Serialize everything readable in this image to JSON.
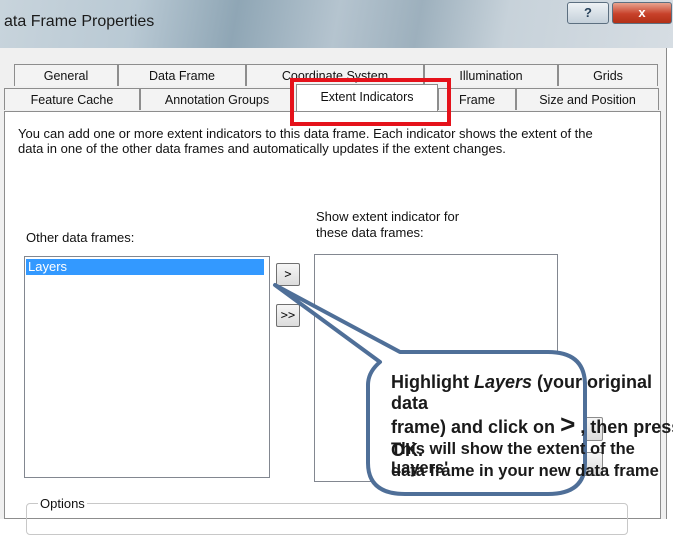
{
  "window": {
    "title": "ata Frame Properties",
    "help_label": "?",
    "close_label": "x"
  },
  "tabs_row1": [
    "General",
    "Data Frame",
    "Coordinate System",
    "Illumination",
    "Grids"
  ],
  "tabs_row2": [
    "Feature Cache",
    "Annotation Groups",
    "Extent Indicators",
    "Frame",
    "Size and Position"
  ],
  "active_tab": "Extent Indicators",
  "description": "You can add one or more extent indicators to this data frame.  Each indicator shows the extent of the data in one of the other data frames and automatically updates if the extent changes.",
  "other_frames": {
    "label": "Other data frames:",
    "items": [
      "Layers"
    ]
  },
  "show_extent": {
    "label_line1": "Show extent indicator for",
    "label_line2": "these data frames:"
  },
  "buttons": {
    "add": ">",
    "add_all": ">>"
  },
  "options_label": "Options",
  "callout": {
    "line1_pre": "Highlight ",
    "line1_em": "Layers",
    "line1_post": " (your original data",
    "line2_pre": "frame) and click on ",
    "line2_sym": ">",
    "line2_post": " , then press OK.",
    "line3": "This will show the extent of the Layers'",
    "line4": "data frame in your new data frame"
  },
  "colors": {
    "highlight_box": "#e5121b",
    "callout_fill": "#ffffff",
    "callout_stroke": "#4f6f98",
    "selection": "#3399ff"
  }
}
